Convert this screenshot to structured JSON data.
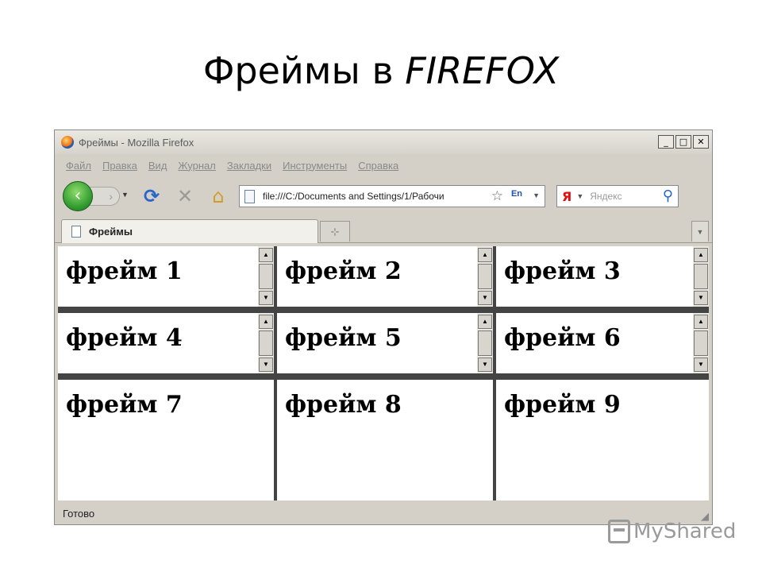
{
  "slide": {
    "title_plain": "Фреймы в ",
    "title_italic": "FIREFOX"
  },
  "window": {
    "title": "Фреймы - Mozilla Firefox",
    "controls": {
      "minimize": "_",
      "maximize": "□",
      "close": "✕"
    }
  },
  "menu": [
    "Файл",
    "Правка",
    "Вид",
    "Журнал",
    "Закладки",
    "Инструменты",
    "Справка"
  ],
  "navigation": {
    "back_glyph": "‹",
    "forward_glyph": "›",
    "url": "file:///C:/Documents and Settings/1/Рабочи",
    "lang": "En",
    "search_brand": "Я",
    "search_placeholder": "Яндекс"
  },
  "tabs": {
    "active_label": "Фреймы",
    "new_tab_glyph": "⊹"
  },
  "frames": [
    {
      "label": "фрейм 1",
      "scroll": true
    },
    {
      "label": "фрейм 2",
      "scroll": true
    },
    {
      "label": "фрейм 3",
      "scroll": true
    },
    {
      "label": "фрейм 4",
      "scroll": true
    },
    {
      "label": "фрейм 5",
      "scroll": true
    },
    {
      "label": "фрейм 6",
      "scroll": true
    },
    {
      "label": "фрейм 7",
      "scroll": false
    },
    {
      "label": "фрейм 8",
      "scroll": false
    },
    {
      "label": "фрейм 9",
      "scroll": false
    }
  ],
  "status": {
    "text": "Готово"
  },
  "watermark": {
    "text": "MyShared"
  },
  "colors": {
    "chrome": "#d4d0c8",
    "back_button": "#2f9a2f",
    "reload": "#2a66c8",
    "yandex": "#e01010"
  }
}
